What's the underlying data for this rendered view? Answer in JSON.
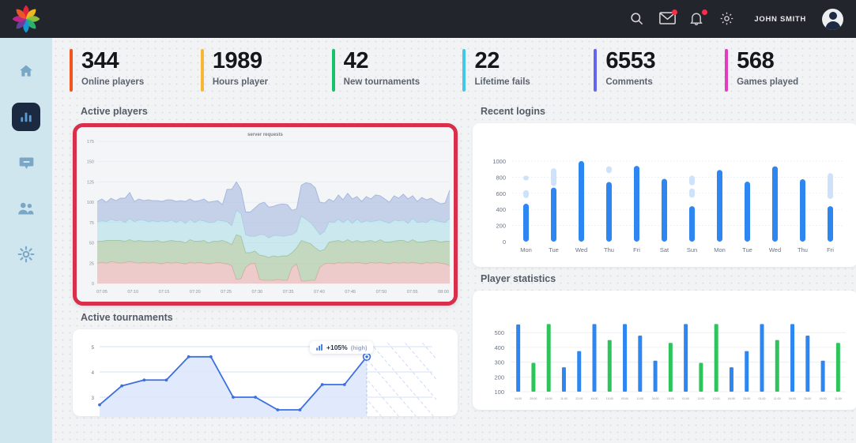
{
  "app": {
    "logo_name": "flower-logo",
    "logo_colors": [
      "#e8243c",
      "#f4c020",
      "#8dc63f",
      "#2bb673",
      "#1b9ad6",
      "#6b3fa0",
      "#c2268f",
      "#f05a28"
    ]
  },
  "topbar": {
    "icons": [
      {
        "name": "search-icon",
        "badge": false
      },
      {
        "name": "mail-icon",
        "badge": true
      },
      {
        "name": "bell-icon",
        "badge": true
      },
      {
        "name": "gear-icon",
        "badge": false
      }
    ],
    "user_name": "JOHN SMITH",
    "avatar_name": "user-avatar",
    "badge_color": "#f2314a",
    "background": "#22252b"
  },
  "sidebar": {
    "background": "#cfe6ef",
    "items": [
      {
        "name": "sidebar-item-home",
        "icon": "home-icon",
        "active": false
      },
      {
        "name": "sidebar-item-analytics",
        "icon": "bar-chart-icon",
        "active": true
      },
      {
        "name": "sidebar-item-messages",
        "icon": "chat-bubble-icon",
        "active": false
      },
      {
        "name": "sidebar-item-users",
        "icon": "users-icon",
        "active": false
      },
      {
        "name": "sidebar-item-settings",
        "icon": "gear-icon",
        "active": false
      }
    ]
  },
  "stats": [
    {
      "value": "344",
      "label": "Online players",
      "color": "#f4541f"
    },
    {
      "value": "1989",
      "label": "Hours player",
      "color": "#f7b733"
    },
    {
      "value": "42",
      "label": "New tournaments",
      "color": "#17c26a"
    },
    {
      "value": "22",
      "label": "Lifetime fails",
      "color": "#45c8e8"
    },
    {
      "value": "6553",
      "label": "Comments",
      "color": "#6366f1"
    },
    {
      "value": "568",
      "label": "Games played",
      "color": "#e839c5"
    }
  ],
  "panels": {
    "active_players": {
      "title": "Active players",
      "highlighted": true,
      "highlight_color": "#d8304a"
    },
    "active_tournaments": {
      "title": "Active tournaments"
    },
    "recent_logins": {
      "title": "Recent logins"
    },
    "player_statistics": {
      "title": "Player statistics"
    }
  },
  "chart_data": [
    {
      "id": "active-players-chart",
      "type": "area",
      "title": "server requests",
      "xlabel": "",
      "ylabel": "",
      "ylim": [
        0,
        175
      ],
      "yticks": [
        0,
        25,
        50,
        75,
        100,
        125,
        150,
        175
      ],
      "grid": true,
      "legend": "none",
      "x": [
        "07:05",
        "07:10",
        "07:15",
        "07:20",
        "07:25",
        "07:30",
        "07:35",
        "07:40",
        "07:45",
        "07:50",
        "07:55",
        "08:00"
      ],
      "stacked": true,
      "series": [
        {
          "name": "tier-1",
          "color": "#e8a7a7",
          "values": [
            25,
            26,
            25,
            27,
            26,
            25,
            26,
            27,
            26,
            25,
            26,
            25,
            26,
            25,
            24,
            26,
            25,
            26,
            25,
            24,
            26,
            25,
            26,
            25,
            24,
            25,
            26,
            25,
            24,
            22,
            5,
            6,
            20,
            24,
            25,
            5,
            4,
            4,
            4,
            5,
            4,
            4,
            20,
            24,
            3,
            3,
            4,
            4,
            20,
            24,
            25,
            24,
            26,
            25,
            26,
            25,
            26,
            25,
            24,
            26,
            25,
            26,
            25,
            24,
            26,
            25,
            26,
            25,
            26,
            25,
            24,
            26,
            25,
            26,
            25,
            24,
            22
          ]
        },
        {
          "name": "tier-2",
          "color": "#9bbf8f",
          "values": [
            27,
            26,
            28,
            26,
            27,
            28,
            26,
            27,
            26,
            28,
            26,
            27,
            26,
            28,
            27,
            26,
            28,
            26,
            27,
            26,
            28,
            27,
            26,
            28,
            26,
            27,
            26,
            28,
            27,
            26,
            55,
            52,
            18,
            14,
            15,
            30,
            30,
            28,
            30,
            28,
            30,
            30,
            18,
            20,
            50,
            48,
            45,
            40,
            20,
            18,
            26,
            28,
            27,
            26,
            28,
            26,
            27,
            26,
            28,
            27,
            26,
            28,
            26,
            27,
            26,
            28,
            27,
            26,
            28,
            26,
            27,
            26,
            28,
            27,
            26,
            28,
            30
          ]
        },
        {
          "name": "tier-3",
          "color": "#a8dce8",
          "values": [
            24,
            25,
            23,
            26,
            24,
            25,
            23,
            26,
            24,
            25,
            26,
            24,
            25,
            23,
            26,
            24,
            25,
            23,
            26,
            24,
            25,
            23,
            26,
            24,
            25,
            23,
            26,
            24,
            25,
            23,
            30,
            28,
            22,
            20,
            18,
            25,
            26,
            24,
            25,
            26,
            24,
            25,
            22,
            20,
            30,
            28,
            26,
            24,
            20,
            22,
            25,
            23,
            26,
            24,
            25,
            23,
            26,
            24,
            25,
            23,
            26,
            24,
            25,
            23,
            26,
            24,
            25,
            23,
            26,
            24,
            25,
            23,
            26,
            24,
            25,
            23,
            28
          ]
        },
        {
          "name": "tier-4",
          "color": "#9fb3dd",
          "values": [
            25,
            27,
            24,
            26,
            25,
            27,
            30,
            32,
            25,
            26,
            24,
            27,
            25,
            26,
            24,
            27,
            25,
            26,
            24,
            27,
            25,
            26,
            24,
            27,
            25,
            26,
            24,
            20,
            40,
            45,
            35,
            30,
            28,
            30,
            35,
            38,
            40,
            38,
            36,
            38,
            40,
            38,
            30,
            28,
            38,
            45,
            48,
            50,
            40,
            35,
            28,
            26,
            30,
            28,
            32,
            30,
            28,
            26,
            30,
            28,
            32,
            30,
            28,
            26,
            30,
            28,
            32,
            30,
            28,
            26,
            30,
            28,
            26,
            24,
            22,
            24,
            35
          ]
        }
      ]
    },
    {
      "id": "active-tournaments-chart",
      "type": "line",
      "title": "",
      "xlabel": "",
      "ylabel": "",
      "ylim": [
        2,
        5
      ],
      "yticks": [
        3,
        4,
        5
      ],
      "grid": true,
      "legend": "none",
      "annotation": {
        "value": "+105%",
        "note": "(high)",
        "icon": "bar-chart-icon"
      },
      "values": [
        2.7,
        3.45,
        3.68,
        3.68,
        4.6,
        4.6,
        3.0,
        3.0,
        2.5,
        2.5,
        3.5,
        3.5,
        4.6
      ],
      "forecast_region": true
    },
    {
      "id": "recent-logins-chart",
      "type": "bar",
      "title": "",
      "xlabel": "",
      "ylabel": "",
      "ylim": [
        0,
        1000
      ],
      "yticks": [
        0,
        200,
        400,
        600,
        800,
        1000
      ],
      "grid": true,
      "legend": "none",
      "bar_color": "#2e86f0",
      "ghost_color": "#cfe2fb",
      "categories": [
        "Mon",
        "Tue",
        "Wed",
        "Thu",
        "Fri",
        "Sat",
        "Sun",
        "Mon",
        "Tue",
        "Wed",
        "Thu",
        "Fri"
      ],
      "values": [
        470,
        670,
        1000,
        740,
        940,
        780,
        440,
        890,
        745,
        935,
        775,
        440
      ],
      "ghost_segments": [
        [
          [
            540,
            640
          ],
          [
            760,
            820
          ]
        ],
        [
          [
            690,
            910
          ]
        ],
        [],
        [
          [
            850,
            935
          ]
        ],
        [],
        [],
        [
          [
            545,
            660
          ],
          [
            700,
            820
          ]
        ],
        [],
        [],
        [],
        [],
        [
          [
            530,
            850
          ]
        ]
      ]
    },
    {
      "id": "player-statistics-chart",
      "type": "bar",
      "title": "",
      "xlabel": "",
      "ylabel": "",
      "ylim": [
        100,
        560
      ],
      "yticks": [
        100,
        200,
        300,
        400,
        500
      ],
      "grid": true,
      "legend": "none",
      "colors": {
        "blue": "#2e86f0",
        "green": "#2ec45c"
      },
      "categories": [
        "04:00",
        "25:00",
        "16:00",
        "11:00",
        "22:00",
        "44:00",
        "15:00",
        "03:00",
        "11:00",
        "34:00",
        "15:00",
        "01:00",
        "11:00",
        "13:00",
        "04:00",
        "25:00",
        "01:00",
        "11:00"
      ],
      "values": [
        555,
        295,
        558,
        265,
        375,
        558,
        450,
        558,
        480,
        310,
        430,
        558,
        295,
        558,
        265,
        375,
        558,
        450,
        558,
        480,
        310,
        430
      ],
      "series": [
        {
          "name": "group-blue",
          "color": "#2e86f0"
        },
        {
          "name": "group-green",
          "color": "#2ec45c"
        }
      ],
      "bars": [
        {
          "v": 555,
          "c": "blue"
        },
        {
          "v": 295,
          "c": "green"
        },
        {
          "v": 558,
          "c": "green"
        },
        {
          "v": 265,
          "c": "blue"
        },
        {
          "v": 375,
          "c": "blue"
        },
        {
          "v": 558,
          "c": "blue"
        },
        {
          "v": 450,
          "c": "green"
        },
        {
          "v": 558,
          "c": "blue"
        },
        {
          "v": 480,
          "c": "blue"
        },
        {
          "v": 310,
          "c": "blue"
        },
        {
          "v": 430,
          "c": "green"
        },
        {
          "v": 558,
          "c": "blue"
        },
        {
          "v": 295,
          "c": "green"
        },
        {
          "v": 558,
          "c": "green"
        },
        {
          "v": 265,
          "c": "blue"
        },
        {
          "v": 375,
          "c": "blue"
        },
        {
          "v": 558,
          "c": "blue"
        },
        {
          "v": 450,
          "c": "green"
        },
        {
          "v": 558,
          "c": "blue"
        },
        {
          "v": 480,
          "c": "blue"
        },
        {
          "v": 310,
          "c": "blue"
        },
        {
          "v": 430,
          "c": "green"
        }
      ]
    }
  ]
}
